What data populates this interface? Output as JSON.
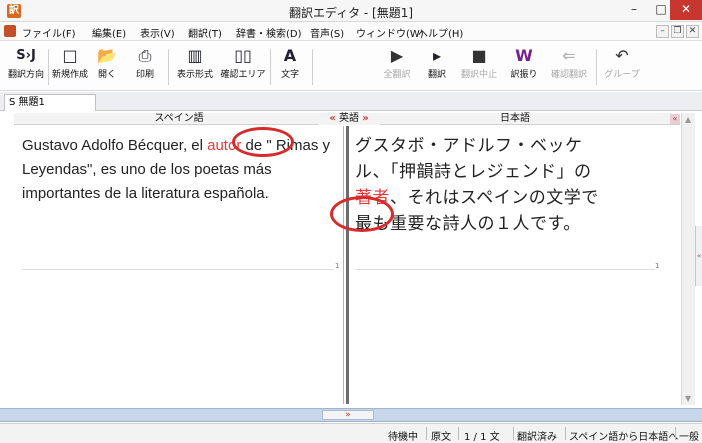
{
  "window": {
    "title": "翻訳エディタ - [無題1]",
    "minimize": "–",
    "maximize": "□",
    "close": "✕"
  },
  "menu": {
    "items": [
      "ファイル(F)",
      "編集(E)",
      "表示(V)",
      "翻訳(T)",
      "辞書・検索(D)",
      "音声(S)",
      "ウィンドウ(W)",
      "ヘルプ(H)"
    ],
    "mdi_min": "–",
    "mdi_restore": "❐",
    "mdi_close": "✕"
  },
  "toolbar": {
    "buttons": [
      {
        "label": "翻訳方向",
        "icon": "S›J",
        "icon_name": "translation-direction-icon",
        "disabled": false
      },
      {
        "label": "新規作成",
        "icon": "□",
        "icon_name": "new-document-icon",
        "disabled": false
      },
      {
        "label": "開く",
        "icon": "📂",
        "icon_name": "open-folder-icon",
        "disabled": false
      },
      {
        "label": "印刷",
        "icon": "⎙",
        "icon_name": "printer-icon",
        "disabled": false
      },
      {
        "label": "表示形式",
        "icon": "▥",
        "icon_name": "display-format-icon",
        "disabled": false
      },
      {
        "label": "確認エリア",
        "icon": "▯▯",
        "icon_name": "confirm-area-icon",
        "disabled": false
      },
      {
        "label": "文字",
        "icon": "A",
        "icon_name": "font-icon",
        "disabled": false
      },
      {
        "label": "全翻訳",
        "icon": "▶",
        "icon_name": "translate-all-icon",
        "disabled": true
      },
      {
        "label": "翻訳",
        "icon": "▸",
        "icon_name": "translate-icon",
        "disabled": false
      },
      {
        "label": "翻訳中止",
        "icon": "■",
        "icon_name": "stop-icon",
        "disabled": true
      },
      {
        "label": "訳振り",
        "icon": "W",
        "icon_name": "ruby-translation-icon",
        "disabled": false
      },
      {
        "label": "確認翻訳",
        "icon": "⇐",
        "icon_name": "confirm-translate-icon",
        "disabled": true
      },
      {
        "label": "グループ",
        "icon": "↶",
        "icon_name": "group-icon",
        "disabled": true
      }
    ]
  },
  "tabs": {
    "doc_tab": "S 無題1"
  },
  "panes": {
    "source_header": "スペイン語",
    "target_header": "日本語",
    "direction_label": "英語",
    "arrow_left": "«",
    "arrow_right": "»",
    "corner": "«",
    "source": {
      "before": "Gustavo Adolfo Bécquer, el ",
      "highlight": "autor",
      "after": " de \" Rimas y Leyendas\", es uno de los poetas más importantes de la literatura española.",
      "row_number": "1"
    },
    "target": {
      "line1": "グスタボ・アドルフ・ベッケ",
      "line2": "ル、「押韻詩とレジェンド」の",
      "highlight": "著者",
      "line3_rest": "、それはスペインの文学で",
      "line4": "最も重要な詩人の１人です。",
      "row_number": "1"
    }
  },
  "splitter": {
    "grip": "»"
  },
  "status": {
    "items": [
      "待機中",
      "原文",
      "1 / 1 文",
      "翻訳済み",
      "スペイン語から日本語へ",
      "一般"
    ]
  },
  "colors": {
    "accent": "#d62b2b",
    "highlight_text": "#e53b3b",
    "splitter": "#c8d6ea"
  }
}
